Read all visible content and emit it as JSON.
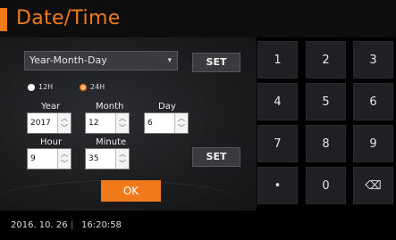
{
  "header": {
    "title": "Date/Time"
  },
  "format": {
    "selected": "Year-Month-Day",
    "set_label": "SET"
  },
  "clock_mode": {
    "options": [
      {
        "label": "12H",
        "selected": false
      },
      {
        "label": "24H",
        "selected": true
      }
    ]
  },
  "date": {
    "year_label": "Year",
    "year": "2017",
    "month_label": "Month",
    "month": "12",
    "day_label": "Day",
    "day": "6"
  },
  "time": {
    "hour_label": "Hour",
    "hour": "9",
    "minute_label": "Minute",
    "minute": "35",
    "set_label": "SET"
  },
  "ok_label": "OK",
  "keypad": {
    "keys": [
      "1",
      "2",
      "3",
      "4",
      "5",
      "6",
      "7",
      "8",
      "9",
      "•",
      "0",
      "⌫"
    ]
  },
  "status": {
    "date": "2016. 10. 26",
    "separator": "|",
    "time": "16:20:58"
  },
  "colors": {
    "accent": "#f07a1a"
  }
}
